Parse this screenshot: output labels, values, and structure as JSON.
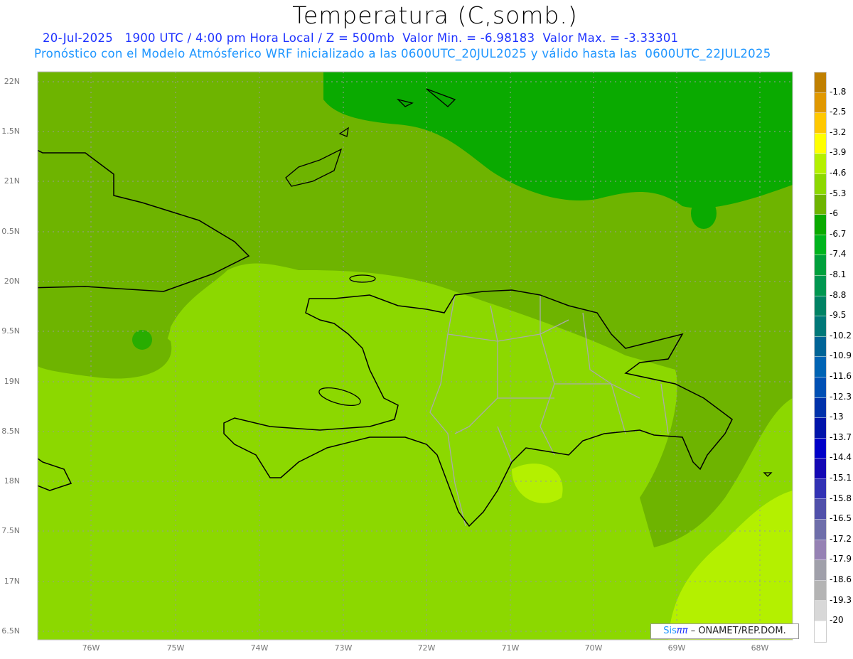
{
  "header": {
    "title": "Temperatura (C,somb.)",
    "subtitle1": "20-Jul-2025   1900 UTC / 4:00 pm Hora Local / Z = 500mb  Valor Min. = -6.98183  Valor Max. = -3.33301",
    "subtitle2": "Pronóstico con el Modelo Atmósferico WRF inicializado a las 0600UTC_20JUL2025 y válido hasta las  0600UTC_22JUL2025"
  },
  "axes": {
    "lat_labels": [
      "22N",
      "1.5N",
      "21N",
      "0.5N",
      "20N",
      "9.5N",
      "19N",
      "8.5N",
      "18N",
      "7.5N",
      "17N",
      "6.5N"
    ],
    "lon_labels": [
      "76W",
      "75W",
      "74W",
      "73W",
      "72W",
      "71W",
      "70W",
      "69W",
      "68W"
    ]
  },
  "credit": {
    "sis": "Sis",
    "pi": "ππ",
    "rest": " – ONAMET/REP.DOM."
  },
  "colorbar": {
    "labels": [
      "-1.8",
      "-2.5",
      "-3.2",
      "-3.9",
      "-4.6",
      "-5.3",
      "-6",
      "-6.7",
      "-7.4",
      "-8.1",
      "-8.8",
      "-9.5",
      "-10.2",
      "-10.9",
      "-11.6",
      "-12.3",
      "-13",
      "-13.7",
      "-14.4",
      "-15.1",
      "-15.8",
      "-16.5",
      "-17.2",
      "-17.9",
      "-18.6",
      "-19.3",
      "-20"
    ],
    "colors": [
      "#c08000",
      "#e09800",
      "#ffc800",
      "#ffff00",
      "#b4f000",
      "#8cd800",
      "#6eb400",
      "#0aaa00",
      "#00b41e",
      "#00a03c",
      "#009650",
      "#008264",
      "#007878",
      "#006496",
      "#0064b4",
      "#0050b4",
      "#0032aa",
      "#0014aa",
      "#0000c8",
      "#1408b4",
      "#3232b4",
      "#5050aa",
      "#6e6eaa",
      "#9682b4",
      "#a0a0aa",
      "#b4b4b4",
      "#d8d8d8",
      "#ffffff"
    ]
  }
}
